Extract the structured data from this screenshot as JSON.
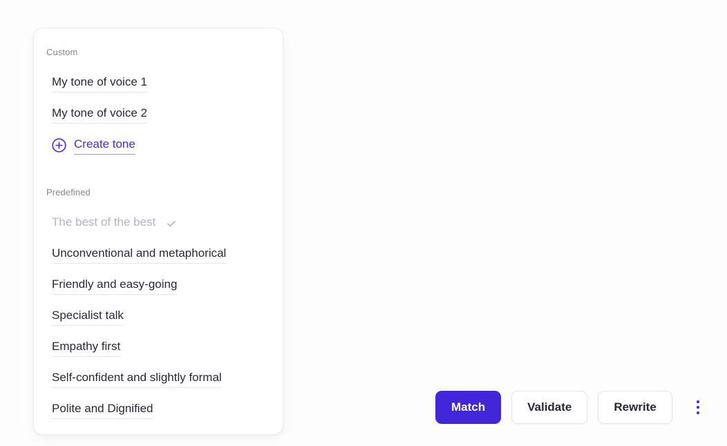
{
  "theme": {
    "accent": "#4226d9",
    "accent_link": "#4a28d6",
    "text_primary": "#272a35",
    "text_muted": "#85878f",
    "text_disabled": "#b2b4bf",
    "card_bg": "#ffffff",
    "page_bg": "#fdfdfd",
    "border": "#e4e5e9"
  },
  "tone_panel": {
    "custom": {
      "label": "Custom",
      "items": [
        {
          "label": "My tone of voice 1",
          "selected": false
        },
        {
          "label": "My tone of voice 2",
          "selected": false
        }
      ],
      "create_action": {
        "label": "Create tone",
        "icon": "plus-circle-icon"
      }
    },
    "predefined": {
      "label": "Predefined",
      "items": [
        {
          "label": "The best of the best",
          "selected": true,
          "icon": "check-icon"
        },
        {
          "label": "Unconventional and metaphorical",
          "selected": false
        },
        {
          "label": "Friendly and easy-going",
          "selected": false
        },
        {
          "label": "Specialist talk",
          "selected": false
        },
        {
          "label": "Empathy first",
          "selected": false
        },
        {
          "label": "Self-confident and slightly formal",
          "selected": false
        },
        {
          "label": "Polite and Dignified",
          "selected": false
        }
      ]
    }
  },
  "action_bar": {
    "match_label": "Match",
    "validate_label": "Validate",
    "rewrite_label": "Rewrite",
    "more_icon": "kebab-menu-icon"
  }
}
